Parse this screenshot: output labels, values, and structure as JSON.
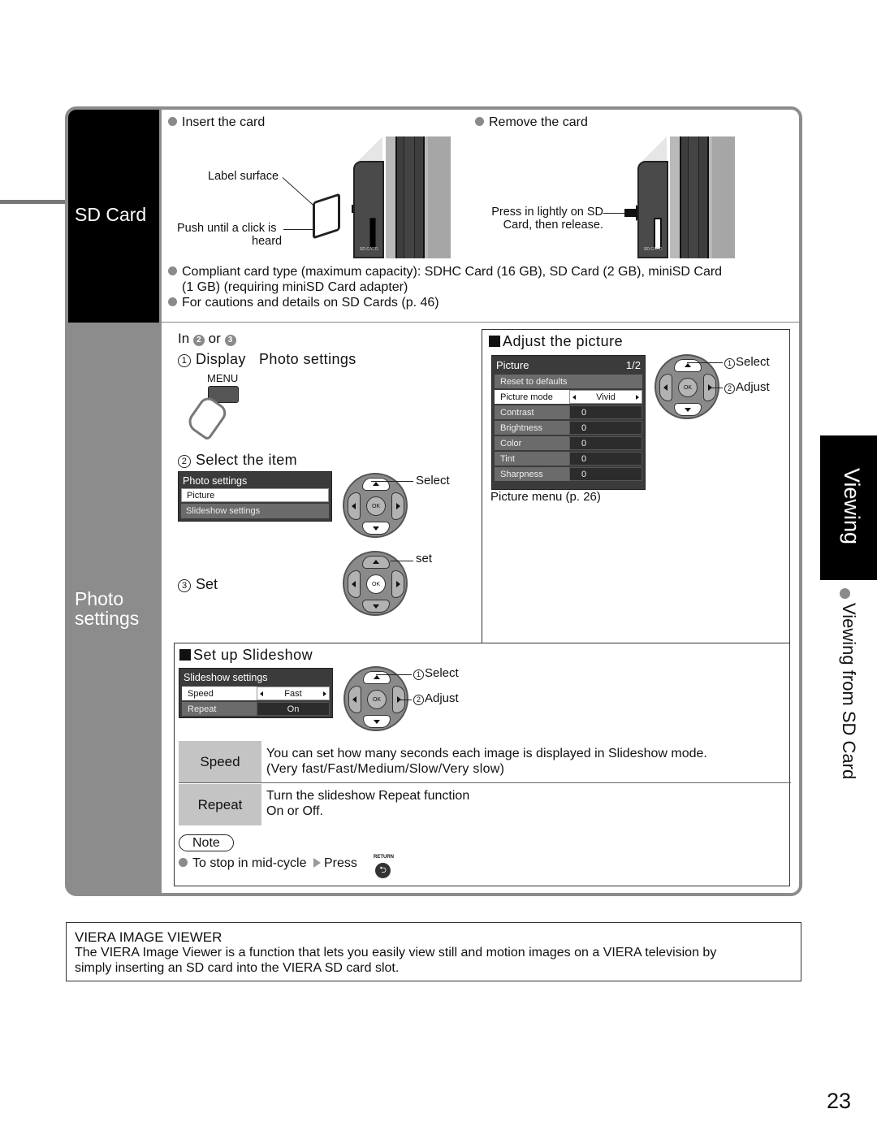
{
  "page_number": "23",
  "side_tab": {
    "section": "Viewing",
    "subsection": "Viewing from SD Card"
  },
  "sd_card": {
    "side_title": "SD Card",
    "insert": {
      "heading": "Insert the card",
      "label_surface": "Label surface",
      "push_line1": "Push until a click is",
      "push_line2": "heard",
      "slot_label": "SD CARD"
    },
    "remove": {
      "heading": "Remove the card",
      "press_line1": "Press in lightly on SD",
      "press_line2": "Card, then release.",
      "slot_label": "SD CARD"
    },
    "notes": [
      "Compliant card type (maximum capacity): SDHC Card (16 GB), SD Card (2 GB), miniSD Card",
      "(1 GB) (requiring miniSD Card adapter)",
      "For cautions and details on SD Cards (p. 46)"
    ]
  },
  "photo_settings": {
    "side_title_line1": "Photo",
    "side_title_line2": "settings",
    "in_prefix": "In",
    "in_step_a": "2",
    "in_or": "or",
    "in_step_b": "3",
    "step1": {
      "num": "1",
      "label": "Display",
      "target": "Photo settings",
      "button": "MENU"
    },
    "step2": {
      "num": "2",
      "label": "Select the item",
      "dpad_label": "Select"
    },
    "step3": {
      "num": "3",
      "label": "Set",
      "dpad_label": "set"
    },
    "menu": {
      "title": "Photo settings",
      "items": [
        "Picture",
        "Slideshow settings"
      ],
      "selected_index": 0
    },
    "ok_label": "OK"
  },
  "adjust_picture": {
    "heading": "Adjust the picture",
    "menu": {
      "title": "Picture",
      "page": "1/2",
      "reset": "Reset to defaults",
      "rows": [
        {
          "label": "Picture mode",
          "value": "Vivid",
          "selected": true
        },
        {
          "label": "Contrast",
          "value": "0"
        },
        {
          "label": "Brightness",
          "value": "0"
        },
        {
          "label": "Color",
          "value": "0"
        },
        {
          "label": "Tint",
          "value": "0"
        },
        {
          "label": "Sharpness",
          "value": "0"
        }
      ]
    },
    "caption": "Picture menu (p. 26)",
    "select_num": "1",
    "select_label": "Select",
    "adjust_num": "2",
    "adjust_label": "Adjust"
  },
  "slideshow": {
    "heading": "Set up Slideshow",
    "menu": {
      "title": "Slideshow settings",
      "rows": [
        {
          "label": "Speed",
          "value": "Fast",
          "selected": true
        },
        {
          "label": "Repeat",
          "value": "On"
        }
      ]
    },
    "select_num": "1",
    "select_label": "Select",
    "adjust_num": "2",
    "adjust_label": "Adjust",
    "table": [
      {
        "name": "Speed",
        "line1": "You can set how many seconds each image is displayed in Slideshow mode.",
        "line2": "(Very fast/Fast/Medium/Slow/Very slow)"
      },
      {
        "name": "Repeat",
        "line1": "Turn the slideshow Repeat function",
        "line2": "On or Off."
      }
    ],
    "note_label": "Note",
    "note_text": "To stop in mid-cycle",
    "note_press": "Press",
    "return_label": "RETURN"
  },
  "viera_box": {
    "title": "VIERA IMAGE VIEWER",
    "text_line1": "The VIERA Image Viewer is a function that lets you easily view still and motion images on a VIERA television by",
    "text_line2": "simply inserting an SD card into the VIERA SD card slot."
  }
}
